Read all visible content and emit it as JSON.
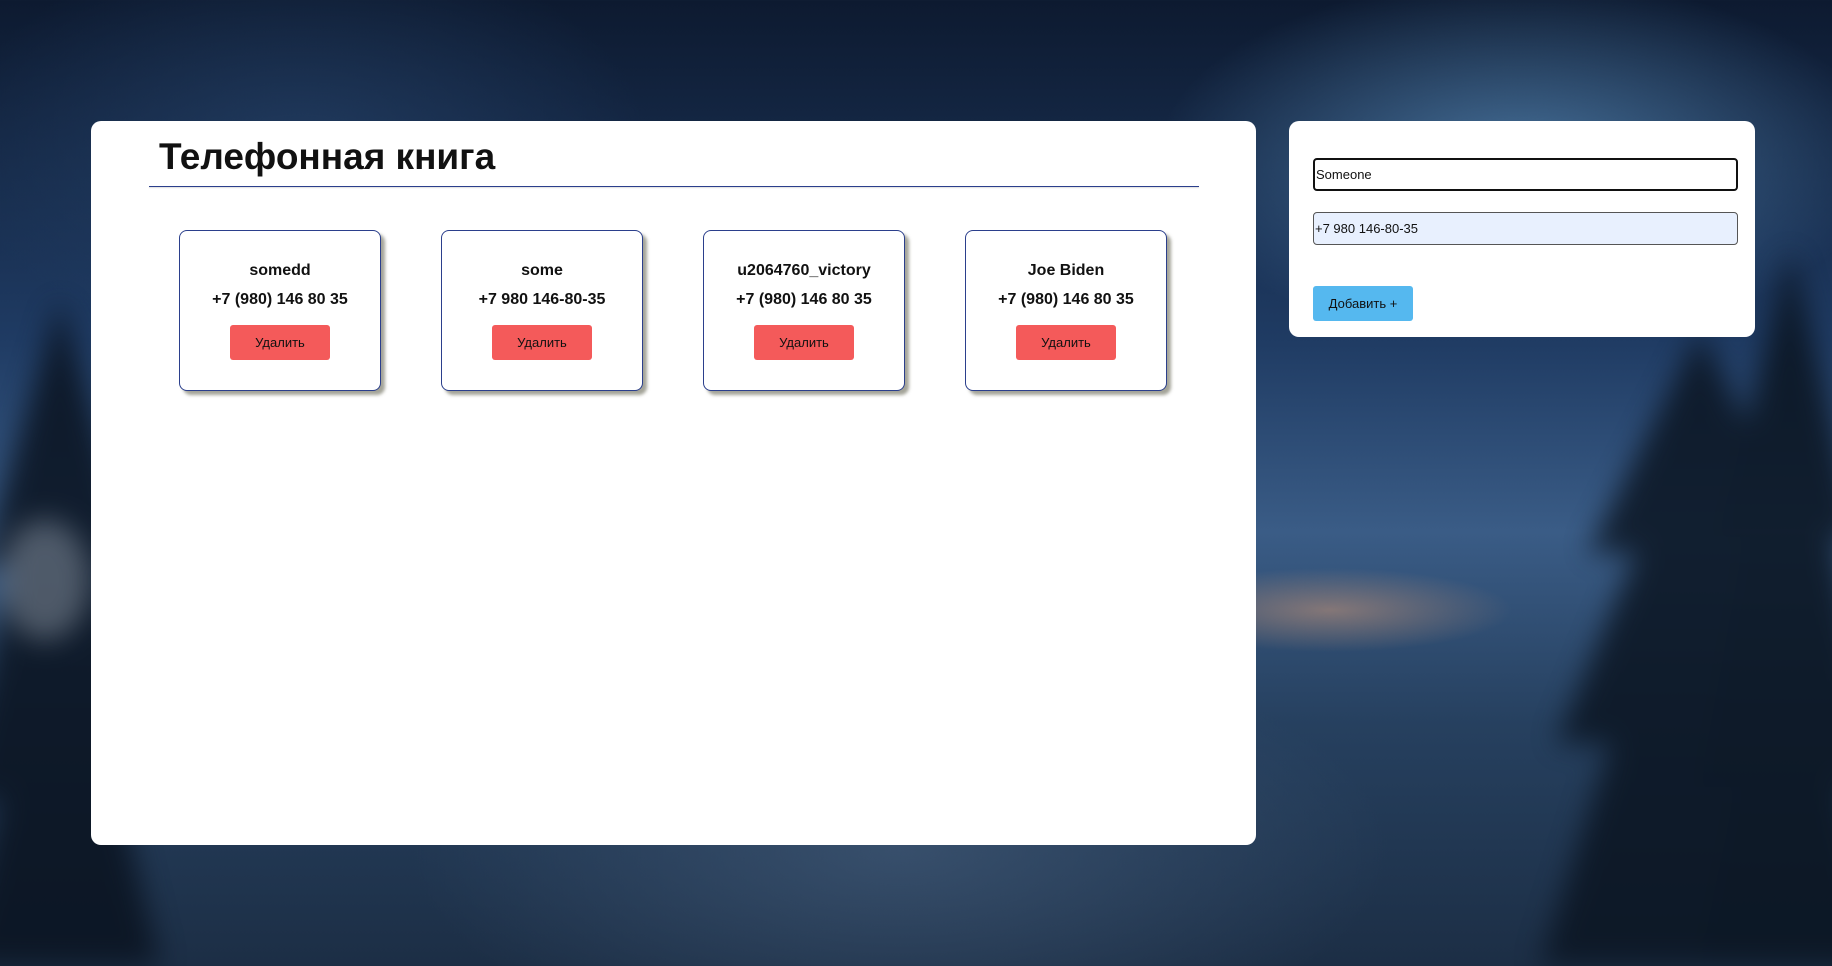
{
  "app": {
    "title": "Телефонная книга"
  },
  "contacts": [
    {
      "name": "somedd",
      "phone": "+7 (980) 146 80 35",
      "delete_label": "Удалить"
    },
    {
      "name": "some",
      "phone": "+7 980 146-80-35",
      "delete_label": "Удалить"
    },
    {
      "name": "u2064760_victory",
      "phone": "+7 (980) 146 80 35",
      "delete_label": "Удалить"
    },
    {
      "name": "Joe Biden",
      "phone": "+7 (980) 146 80 35",
      "delete_label": "Удалить"
    }
  ],
  "form": {
    "name_value": "Someone",
    "phone_value": "+7 980 146-80-35",
    "add_label": "Добавить +"
  },
  "colors": {
    "delete_button": "#f45a5a",
    "add_button": "#55b8ef",
    "card_border": "#2b3f8c",
    "autofill_bg": "#e8f0fe"
  }
}
